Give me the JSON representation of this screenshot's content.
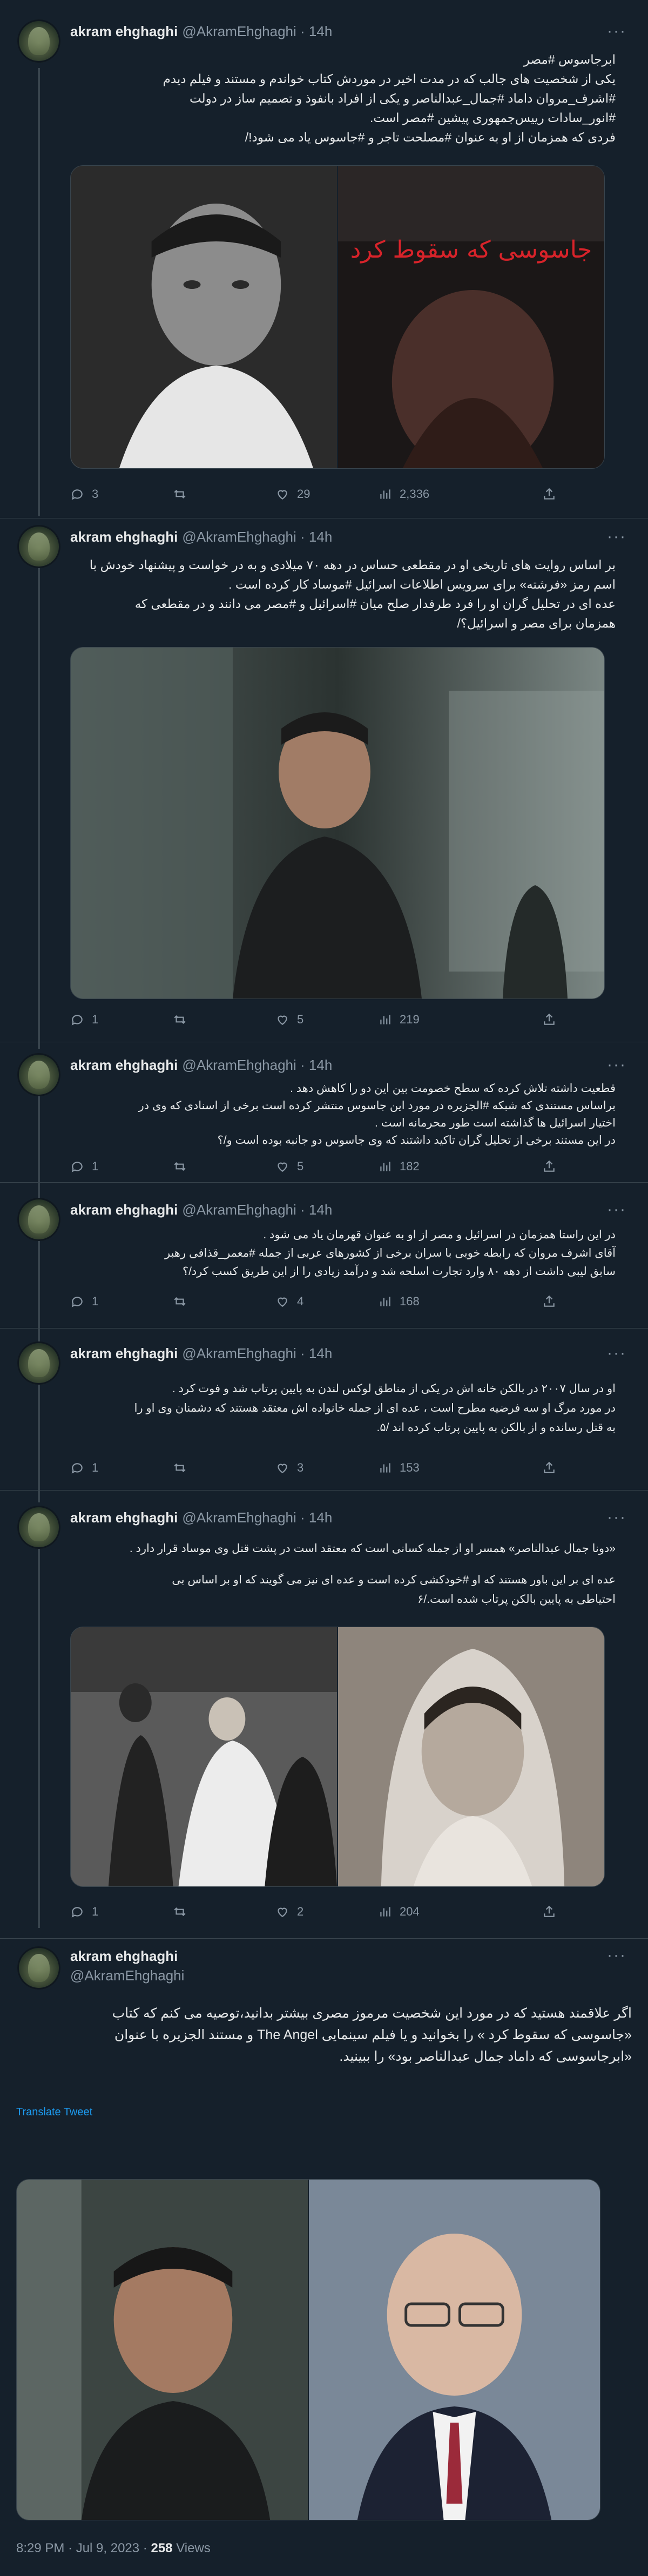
{
  "author": {
    "name": "akram ehghaghi",
    "handle": "@AkramEhghaghi",
    "age": "14h",
    "more": "···"
  },
  "colors": {
    "background": "#15202b",
    "text": "#e7e9ea",
    "muted": "#8b98a5",
    "accent": "#1d9bf0",
    "border": "#38444d"
  },
  "tweets": [
    {
      "lines": [
        "ابرجاسوس #مصر",
        "یکی از شخصیت های جالب که در مدت اخیر در موردش کتاب خواندم و مستند و فیلم دیدم",
        "#اشرف_مروان داماد #جمال_عبدالناصر و یکی از افراد بانفوذ و تصمیم ساز در دولت",
        "#انور_سادات رییس‌جمهوری پیشین #مصر است.",
        "فردی که همزمان از او به عنوان #مصلحت تاجر و #جاسوس یاد می شود!/"
      ],
      "media": {
        "right_title": "جاسوسی که سقوط کرد"
      },
      "stats": {
        "replies": "3",
        "retweets": "",
        "likes": "29",
        "views": "2,336"
      }
    },
    {
      "lines": [
        "بر اساس روایت های تاریخی او در مقطعی حساس در دهه ۷۰ میلادی و به در خواست و پیشنهاد خودش با",
        "اسم رمز «فرشته» برای سرویس اطلاعات اسرائیل #موساد کار کرده است .",
        "عده ای در تحلیل گران او را فرد طرفدار صلح میان #اسرائیل و #مصر می دانند و در مقطعی که",
        "همزمان برای مصر و اسرائیل؟/"
      ],
      "stats": {
        "replies": "1",
        "retweets": "",
        "likes": "5",
        "views": "219"
      }
    },
    {
      "lines": [
        "قطعیت داشته  تلاش کرده که سطح خصومت بین این دو را کاهش دهد .",
        "براساس مستندی که شبکه #الجزیره در مورد این جاسوس منتشر کرده است برخی از اسنادی که وی در",
        "اختیار اسرائیل ها گذاشته است طور محرمانه است .",
        "در این مستند برخی از تحلیل گران تاکید داشتند که وی جاسوس دو جانبه بوده است و/؟"
      ],
      "stats": {
        "replies": "1",
        "retweets": "",
        "likes": "5",
        "views": "182"
      }
    },
    {
      "lines": [
        "در این راستا همزمان در اسرائیل و مصر از او به عنوان قهرمان یاد می شود .",
        "آقای اشرف مروان که رابطه خوبی با سران برخی از کشورهای عربی از جمله #معمر_قذافی رهبر",
        "سابق لیبی داشت از دهه ۸۰ وارد تجارت اسلحه شد و درآمد زیادی را از این طریق کسب کرد/؟"
      ],
      "stats": {
        "replies": "1",
        "retweets": "",
        "likes": "4",
        "views": "168"
      }
    },
    {
      "lines": [
        "او در سال ۲۰۰۷ در بالکن خانه اش در یکی از مناطق لوکس لندن به پایین پرتاب شد و فوت کرد .",
        "در مورد مرگ او سه فرضیه مطرح است ، عده ای از جمله خانواده اش معتقد هستند که دشمنان وی او را",
        "به قتل رسانده و از بالکن به پایین پرتاب کرده اند /۵."
      ],
      "stats": {
        "replies": "1",
        "retweets": "",
        "likes": "3",
        "views": "153"
      }
    },
    {
      "lines": [
        "«دونا جمال عبدالناصر» همسر او از جمله کسانی است که معتقد است در پشت قتل وی موساد قرار دارد .",
        "عده ای بر این باور هستند که او #خودکشی کرده است و عده ای نیز می گویند که او بر اساس بی",
        "احتیاطی به پایین بالکن پرتاب شده است./۶"
      ],
      "stats": {
        "replies": "1",
        "retweets": "",
        "likes": "2",
        "views": "204"
      }
    },
    {
      "lines": [
        "اگر علاقمند هستید که در مورد این شخصیت مرموز مصری بیشتر بدانید،توصیه می کنم که کتاب",
        "«جاسوسی که سقوط کرد » را بخوانید و یا فیلم سینمایی The Angel و مستند الجزیره با عنوان",
        "«ابرجاسوسی که داماد جمال عبدالناصر بود» را ببینید."
      ],
      "translate": "Translate Tweet",
      "meta": {
        "time": "8:29 PM · Jul 9, 2023",
        "views": "258",
        "views_label": "Views"
      }
    }
  ]
}
